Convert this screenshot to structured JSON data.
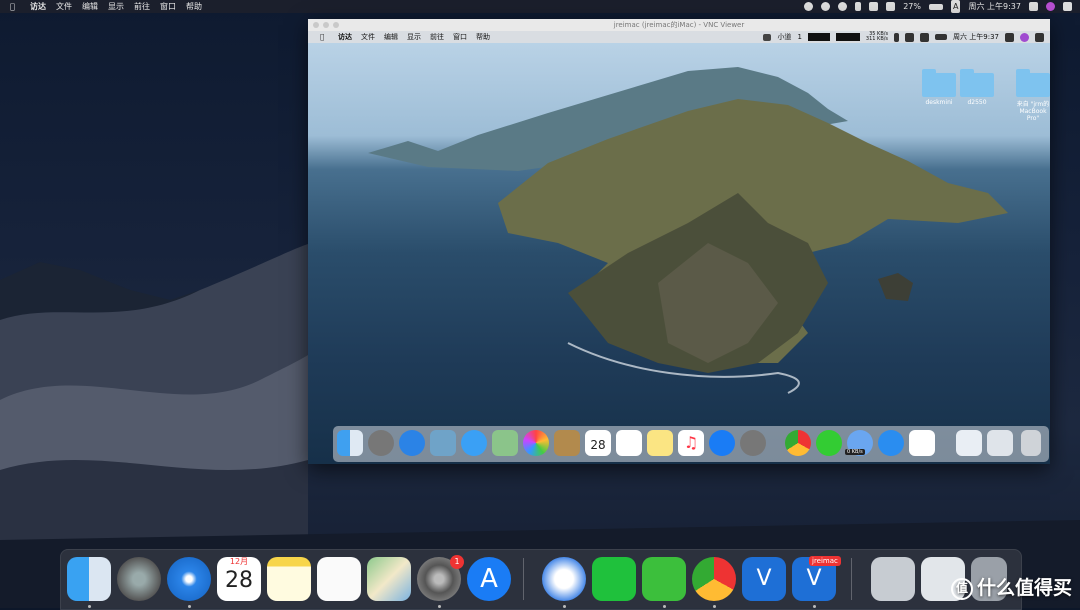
{
  "host_menubar": {
    "app": "访达",
    "menus": [
      "文件",
      "编辑",
      "显示",
      "前往",
      "窗口",
      "帮助"
    ],
    "battery": "27%",
    "input": "A",
    "clock": "周六 上午9:37"
  },
  "vnc_window": {
    "title": "jreimac (jreimac的iMac) - VNC Viewer",
    "remote_menubar": {
      "app": "访达",
      "menus": [
        "文件",
        "编辑",
        "显示",
        "前往",
        "窗口",
        "帮助"
      ],
      "status": "小道",
      "status_num": "1",
      "net_up": "35 KB/s",
      "net_down": "311 KB/s",
      "clock": "周六 上午9:37"
    },
    "desktop_items": [
      {
        "label": "deskmini"
      },
      {
        "label": "d2550"
      },
      {
        "label": "来自 \"jrm的 MacBook Pro\""
      }
    ],
    "dock_speed": "0 KB/s",
    "calendar_day": "28"
  },
  "main_dock": {
    "calendar_month": "12月",
    "calendar_day": "28",
    "sysprefs_badge": "1",
    "vnc_label": "jreimac"
  },
  "watermark": "什么值得买",
  "colors": {
    "accent": "#1a7cf5",
    "badge": "#e33333"
  }
}
